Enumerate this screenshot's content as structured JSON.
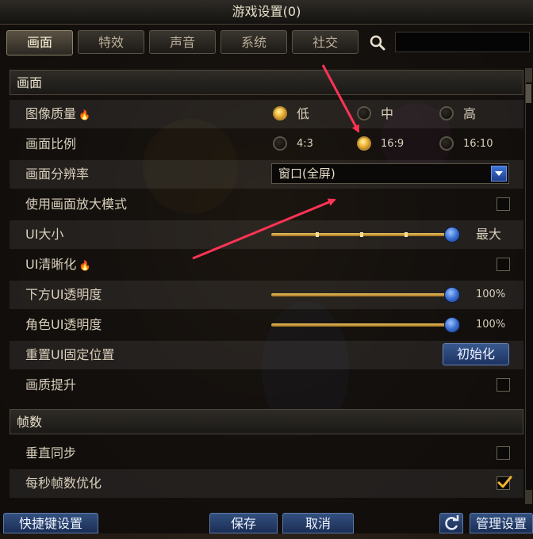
{
  "window": {
    "title": "游戏设置(0)"
  },
  "tabs": [
    {
      "label": "画面"
    },
    {
      "label": "特效"
    },
    {
      "label": "声音"
    },
    {
      "label": "系统"
    },
    {
      "label": "社交"
    }
  ],
  "search": {
    "value": "",
    "icon": "search-icon"
  },
  "sections": {
    "display": {
      "title": "画面"
    },
    "fps": {
      "title": "帧数"
    }
  },
  "settings": {
    "image_quality": {
      "label": "图像质量",
      "options": [
        "低",
        "中",
        "高"
      ],
      "selected": "低"
    },
    "aspect_ratio": {
      "label": "画面比例",
      "options": [
        "4:3",
        "16:9",
        "16:10"
      ],
      "selected": "16:9"
    },
    "resolution": {
      "label": "画面分辨率",
      "value": "窗口(全屏)"
    },
    "zoom_mode": {
      "label": "使用画面放大模式",
      "checked": false
    },
    "ui_size": {
      "label": "UI大小",
      "value_label": "最大",
      "level": 1.0
    },
    "ui_sharpness": {
      "label": "UI清晰化",
      "checked": false
    },
    "bottom_ui_opacity": {
      "label": "下方UI透明度",
      "value_label": "100%",
      "level": 1.0
    },
    "char_ui_opacity": {
      "label": "角色UI透明度",
      "value_label": "100%",
      "level": 1.0
    },
    "reset_ui": {
      "label": "重置UI固定位置",
      "button": "初始化"
    },
    "quality_boost": {
      "label": "画质提升",
      "checked": false
    },
    "vsync": {
      "label": "垂直同步",
      "checked": false
    },
    "fps_opt": {
      "label": "每秒帧数优化",
      "checked": true
    }
  },
  "footer": {
    "shortcuts": "快捷键设置",
    "save": "保存",
    "cancel": "取消",
    "manage": "管理设置",
    "refresh_icon": "refresh-icon"
  },
  "colors": {
    "accent_gold": "#e9c160",
    "knob_blue": "#3a6fd0",
    "annotation_red": "#ff3355"
  }
}
